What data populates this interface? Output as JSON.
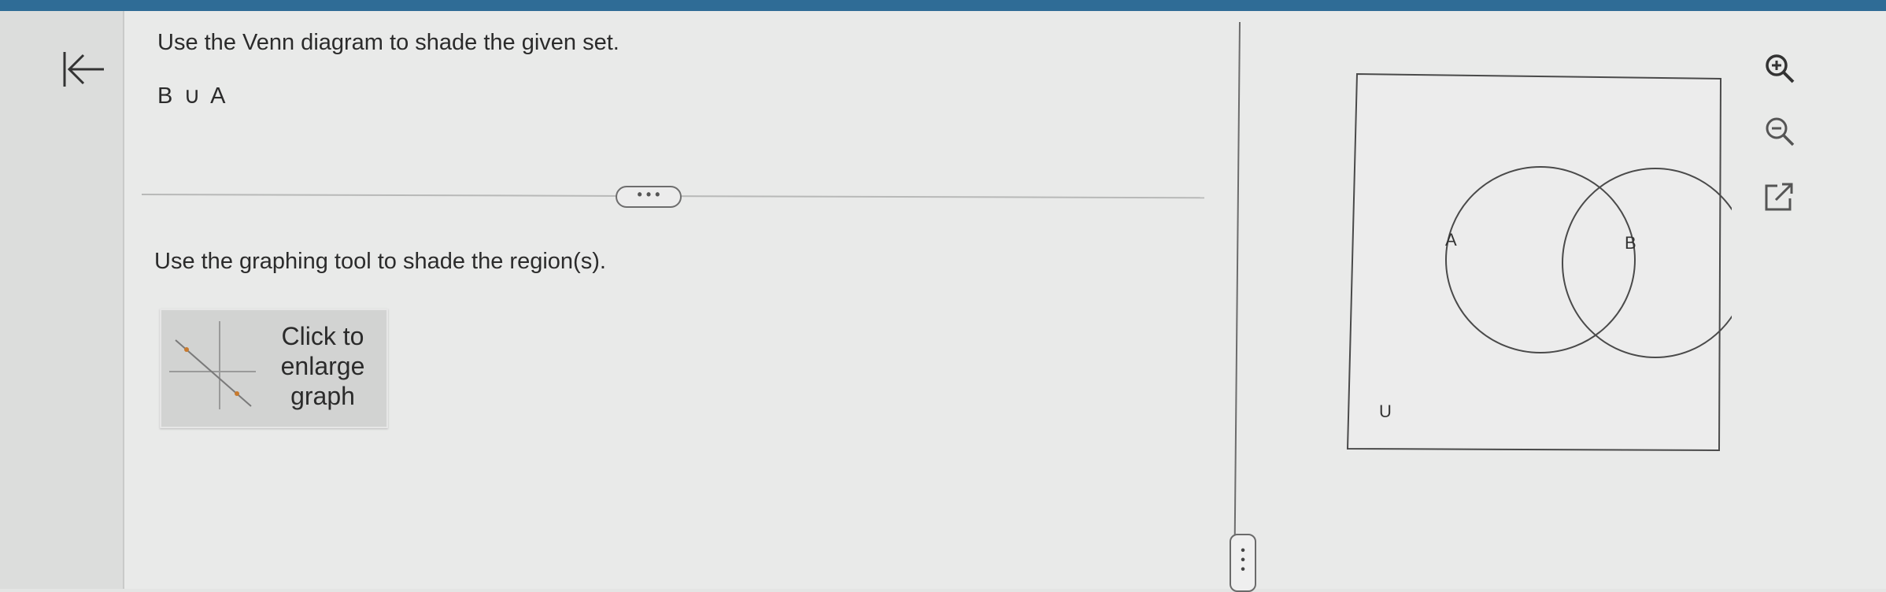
{
  "question": {
    "instruction": "Use the Venn diagram to shade the given set.",
    "set_expression": "B ∪ A"
  },
  "expand_button": {
    "label": "• • •",
    "icon": "ellipsis-icon"
  },
  "tool": {
    "instruction": "Use the graphing tool to shade the region(s).",
    "enlarge_line1": "Click to",
    "enlarge_line2": "enlarge",
    "enlarge_line3": "graph"
  },
  "venn": {
    "label_a": "A",
    "label_b": "B",
    "label_u": "U"
  },
  "icons": {
    "back": "back-arrow-icon",
    "zoom_in": "zoom-in-icon",
    "zoom_out": "zoom-out-icon",
    "popout": "external-link-icon"
  },
  "colors": {
    "top_bar": "#2f6c96",
    "line": "#4a4a4a",
    "thumb_accent": "#c87a2e"
  }
}
